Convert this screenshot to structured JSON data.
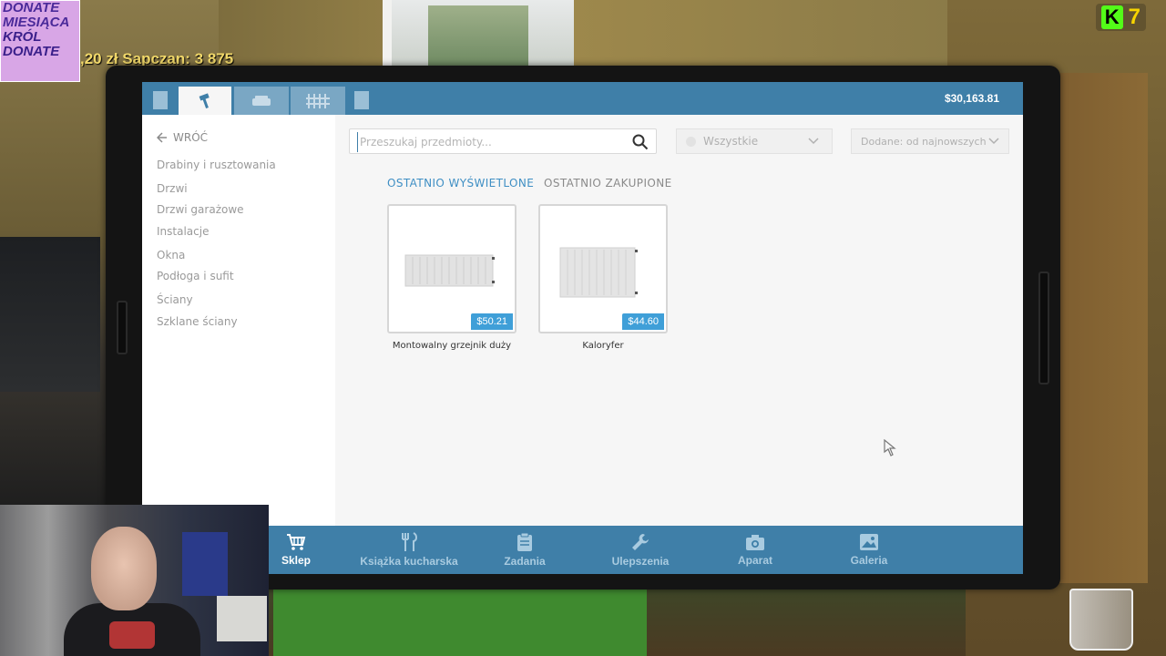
{
  "overlay": {
    "donate_lines": [
      "DONATE",
      "MIESIĄCA",
      "KRÓL",
      "DONATE"
    ],
    "ticker": ",20 zł Sapczan: 3 875",
    "kick_count": "7"
  },
  "tablet": {
    "balance": "$30,163.81",
    "top_tabs": [
      {
        "name": "tools",
        "icon": "hammer-icon",
        "active": true
      },
      {
        "name": "furniture",
        "icon": "sofa-icon",
        "active": false
      },
      {
        "name": "fences",
        "icon": "fence-icon",
        "active": false
      }
    ],
    "sidebar": {
      "back_label": "WRÓĆ",
      "categories": [
        "Drabiny i rusztowania",
        "Drzwi",
        "Drzwi garażowe",
        "Instalacje",
        "Okna",
        "Podłoga i sufit",
        "Ściany",
        "Szklane ściany"
      ]
    },
    "search": {
      "placeholder": "Przeszukaj przedmioty..."
    },
    "filters": {
      "category_value": "Wszystkie",
      "sort_value": "Dodane: od najnowszych"
    },
    "view_tabs": {
      "recent_viewed": "Ostatnio wyświetlone",
      "recent_bought": "Ostatnio zakupione"
    },
    "items": [
      {
        "name": "Montowalny grzejnik duży",
        "price": "$50.21"
      },
      {
        "name": "Kaloryfer",
        "price": "$44.60"
      }
    ],
    "bottom_nav": [
      {
        "label": "Sklep",
        "icon": "cart-icon",
        "active": true
      },
      {
        "label": "Książka kucharska",
        "icon": "cutlery-icon",
        "active": false
      },
      {
        "label": "Zadania",
        "icon": "clipboard-icon",
        "active": false
      },
      {
        "label": "Ulepszenia",
        "icon": "wrench-icon",
        "active": false
      },
      {
        "label": "Aparat",
        "icon": "camera-icon",
        "active": false
      },
      {
        "label": "Galeria",
        "icon": "image-icon",
        "active": false
      }
    ]
  },
  "colors": {
    "accent": "#3f7fa8",
    "price_badge": "#3f9fd8",
    "active_view_tab": "#3f8fc4"
  }
}
